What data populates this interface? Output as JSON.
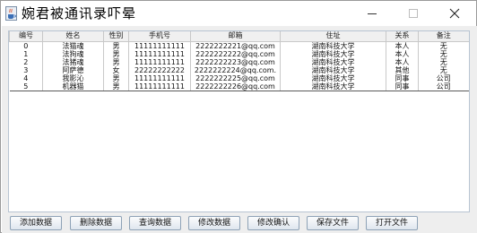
{
  "window": {
    "title": "婉君被通讯录吓晕",
    "icons": {
      "app": "java-cup-icon",
      "minimize": "minimize-icon",
      "maximize": "maximize-icon",
      "close": "close-icon"
    }
  },
  "table": {
    "columns": [
      "编号",
      "姓名",
      "性别",
      "手机号",
      "邮箱",
      "住址",
      "关系",
      "备注"
    ],
    "rows": [
      [
        "0",
        "法猫魂",
        "男",
        "11111111111",
        "2222222221@qq.com",
        "湖南科技大学",
        "本人",
        "无"
      ],
      [
        "1",
        "法狗魂",
        "男",
        "11111111111",
        "2222222222@qq.com",
        "湖南科技大学",
        "本人",
        "无"
      ],
      [
        "2",
        "法猪魂",
        "男",
        "11111111111",
        "2222222223@qq.com",
        "湖南科技大学",
        "本人",
        "无"
      ],
      [
        "3",
        "阿萨德",
        "女",
        "22222222222",
        "2222222224@qq.com.",
        "湖南科技大学",
        "其他",
        "无"
      ],
      [
        "4",
        "我影沁",
        "男",
        "11111111111",
        "2222222225@qq.com",
        "湖南科技大学",
        "同事",
        "公司"
      ],
      [
        "5",
        "机器猫",
        "男",
        "11111111111",
        "2222222226@qq.com",
        "湖南科技大学",
        "同事",
        "公司"
      ]
    ]
  },
  "buttons": {
    "add": "添加数据",
    "delete": "删除数据",
    "query": "查询数据",
    "modify": "修改数据",
    "confirm_modify": "修改确认",
    "save_file": "保存文件",
    "open_file": "打开文件"
  }
}
